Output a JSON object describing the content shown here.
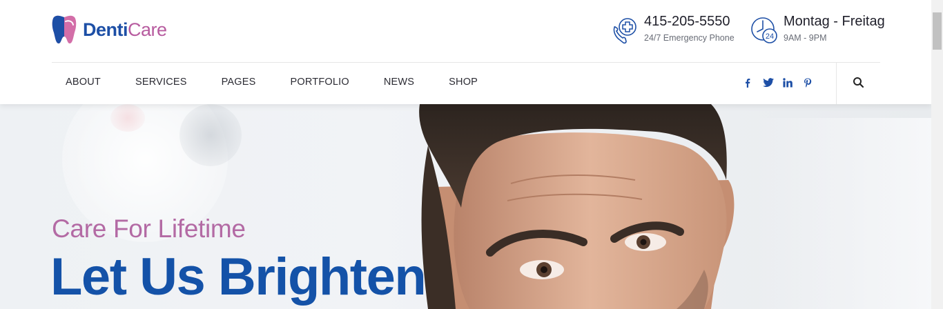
{
  "brand": {
    "name_part1": "Denti",
    "name_part2": "Care"
  },
  "contacts": [
    {
      "icon": "phone-medical-icon",
      "title": "415-205-5550",
      "subtitle": "24/7 Emergency Phone"
    },
    {
      "icon": "clock-24-icon",
      "title": "Montag - Freitag",
      "subtitle": "9AM - 9PM"
    }
  ],
  "nav": [
    "ABOUT",
    "SERVICES",
    "PAGES",
    "PORTFOLIO",
    "NEWS",
    "SHOP"
  ],
  "social": [
    "facebook-icon",
    "twitter-icon",
    "linkedin-icon",
    "pinterest-icon"
  ],
  "search_icon": "search-icon",
  "hero": {
    "tagline": "Care For Lifetime",
    "headline": "Let Us Brighten"
  },
  "colors": {
    "primary_blue": "#1452a8",
    "accent_pink": "#b36aa4"
  }
}
